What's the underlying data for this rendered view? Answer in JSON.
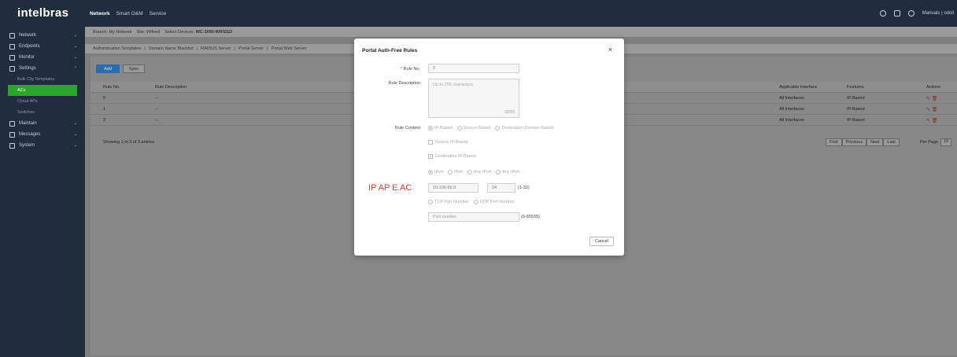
{
  "header": {
    "logo": "intelbras",
    "nav": [
      "Network",
      "Smart O&M",
      "Service"
    ],
    "right_label": "Manuals | odoli"
  },
  "sidebar": {
    "items": [
      {
        "label": "Network",
        "icon": "globe-icon"
      },
      {
        "label": "Endpoints",
        "icon": "device-icon"
      },
      {
        "label": "Monitor",
        "icon": "monitor-icon"
      },
      {
        "label": "Settings",
        "icon": "settings-icon"
      },
      {
        "label": "Maintain",
        "icon": "maintain-icon"
      },
      {
        "label": "Messages",
        "icon": "bell-icon"
      },
      {
        "label": "System",
        "icon": "gear-icon"
      }
    ],
    "settings_sub": [
      "Bulk Cfg Templates",
      "ACs",
      "Cloud APs",
      "Switches"
    ]
  },
  "breadcrumb": {
    "branch": "Branch: My Network",
    "site": "Site: Wifeed",
    "device_label": "Select Devices: ",
    "device_value": "WC-3000-WIFEED"
  },
  "subtabs": [
    "Authentication Templates",
    "Domain Name Blacklist",
    "RADIUS Server",
    "Portal Server",
    "Portal Web Server"
  ],
  "toolbar": {
    "add": "Add",
    "sync": "Sync"
  },
  "table": {
    "headers": [
      "Rule No.",
      "Rule Description",
      "Applicable Interface",
      "Features",
      "Actions"
    ],
    "rows": [
      [
        "0",
        "--",
        "All Interfaces",
        "IP-Based"
      ],
      [
        "1",
        "--",
        "All Interfaces",
        "IP-Based"
      ],
      [
        "2",
        "--",
        "All Interfaces",
        "IP-Based"
      ]
    ],
    "footer": "Showing 1 to 3 of 3 entries",
    "pager": [
      "First",
      "Previous",
      "Next",
      "Last"
    ],
    "per_page_label": "Per Page",
    "per_page_value": "10"
  },
  "modal": {
    "title": "Portal Auth-Free Rules",
    "close": "×",
    "rule_no_label": "Rule No.",
    "rule_no_value": "0",
    "rule_desc_label": "Rule Description",
    "rule_desc_placeholder": "Up to 255 characters",
    "rule_desc_count": "0/255",
    "rule_content_label": "Rule Content",
    "rule_content_options": [
      "IP-Based",
      "Source-Based",
      "Destination Domain-Based"
    ],
    "source_ip": "Source IP-Based",
    "dest_ip": "Destination IP-Based",
    "ip_options": [
      "IPv4",
      "IPv6",
      "Any IPv4",
      "Any IPv6"
    ],
    "annotation": "IP AP E AC",
    "ip_value": "10.100.65.0",
    "mask_value": "24",
    "mask_range": "(1-32)",
    "port_options": [
      "TCP Port Number",
      "UDP Port Number"
    ],
    "port_placeholder": "Port number",
    "port_range": "(0-65535)",
    "cancel": "Cancel"
  }
}
